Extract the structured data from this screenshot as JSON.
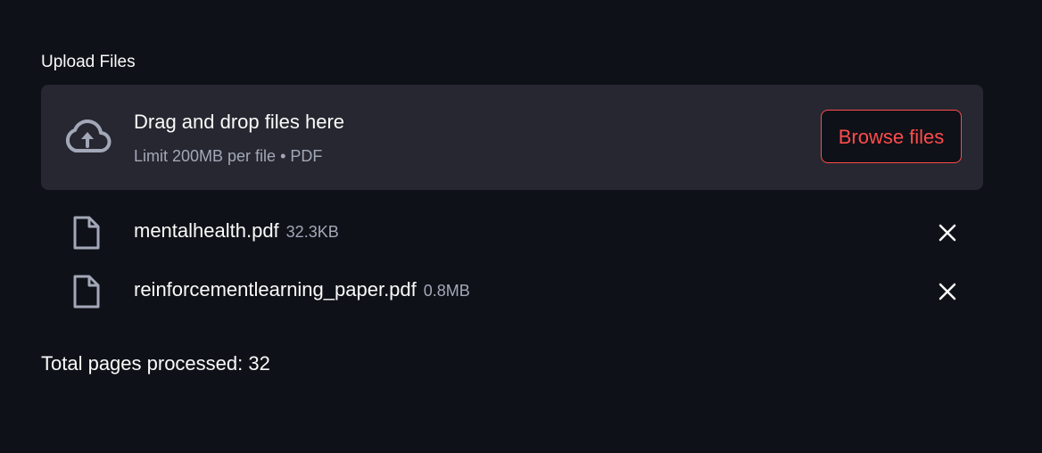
{
  "uploader": {
    "label": "Upload Files",
    "dropzone_title": "Drag and drop files here",
    "dropzone_subtitle": "Limit 200MB per file • PDF",
    "browse_label": "Browse files",
    "upload_icon": "cloud-upload-icon"
  },
  "files": [
    {
      "name": "mentalhealth.pdf",
      "size": "32.3KB",
      "icon": "file-icon",
      "remove_icon": "close-icon"
    },
    {
      "name": "reinforcementlearning_paper.pdf",
      "size": "0.8MB",
      "icon": "file-icon",
      "remove_icon": "close-icon"
    }
  ],
  "status": {
    "total_text": "Total pages processed: 32"
  },
  "colors": {
    "background": "#0e1117",
    "dropzone": "#262730",
    "accent": "#ff4b4b",
    "muted_text": "#a3a8b8"
  }
}
